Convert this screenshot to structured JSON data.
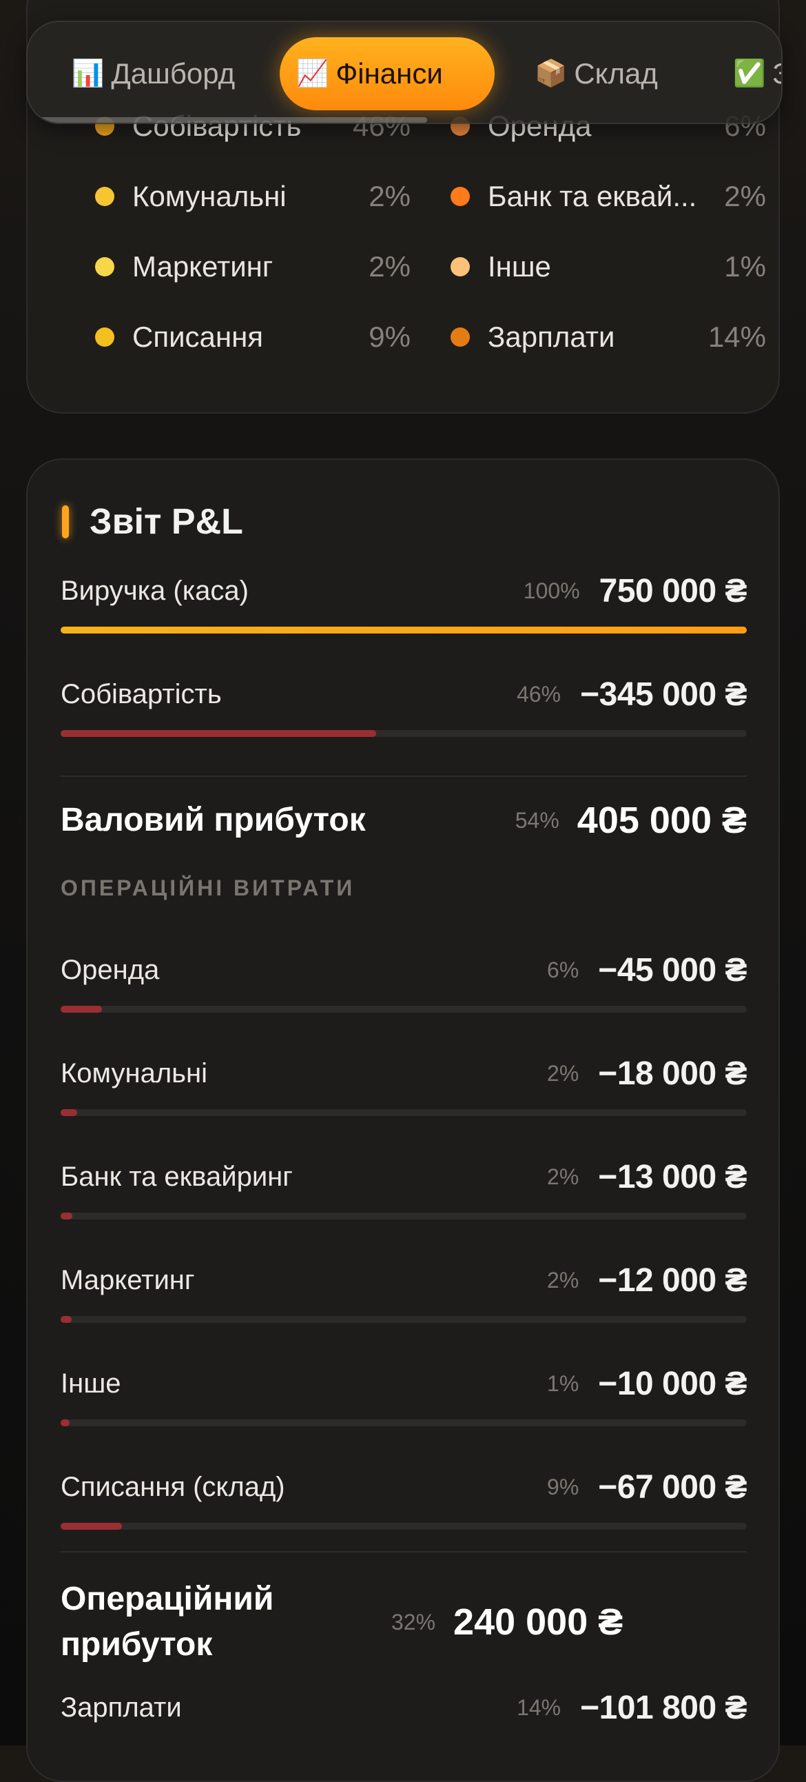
{
  "tabs": [
    {
      "icon": "📊",
      "label": "Дашборд",
      "active": false
    },
    {
      "icon": "📈",
      "label": "Фінанси",
      "active": true
    },
    {
      "icon": "📦",
      "label": "Склад",
      "active": false
    },
    {
      "icon": "✅",
      "label": "З",
      "active": false
    }
  ],
  "legend": [
    {
      "name": "Собівартість",
      "pct": "46%",
      "color": "#f0a81a"
    },
    {
      "name": "Оренда",
      "pct": "6%",
      "color": "#f08a3c"
    },
    {
      "name": "Комунальні",
      "pct": "2%",
      "color": "#f6c532"
    },
    {
      "name": "Банк та еквай...",
      "pct": "2%",
      "color": "#ff7a1a"
    },
    {
      "name": "Маркетинг",
      "pct": "2%",
      "color": "#f7d74a"
    },
    {
      "name": "Інше",
      "pct": "1%",
      "color": "#ffc07a"
    },
    {
      "name": "Списання",
      "pct": "9%",
      "color": "#f3c01d"
    },
    {
      "name": "Зарплати",
      "pct": "14%",
      "color": "#e37d13"
    }
  ],
  "pl": {
    "title": "Звіт P&L",
    "revenue": {
      "label": "Виручка (каса)",
      "pct": "100%",
      "value": "750 000 ₴",
      "fill": 1.0
    },
    "cogs": {
      "label": "Собівартість",
      "pct": "46%",
      "value": "−345 000 ₴",
      "fill": 0.46
    },
    "gross": {
      "label": "Валовий прибуток",
      "pct": "54%",
      "value": "405 000 ₴"
    },
    "opex_caption": "ОПЕРАЦІЙНІ ВИТРАТИ",
    "opex": [
      {
        "label": "Оренда",
        "pct": "6%",
        "value": "−45 000 ₴",
        "fill": 0.06
      },
      {
        "label": "Комунальні",
        "pct": "2%",
        "value": "−18 000 ₴",
        "fill": 0.024
      },
      {
        "label": "Банк та еквайринг",
        "pct": "2%",
        "value": "−13 000 ₴",
        "fill": 0.017
      },
      {
        "label": "Маркетинг",
        "pct": "2%",
        "value": "−12 000 ₴",
        "fill": 0.016
      },
      {
        "label": "Інше",
        "pct": "1%",
        "value": "−10 000 ₴",
        "fill": 0.013
      },
      {
        "label": "Списання (склад)",
        "pct": "9%",
        "value": "−67 000 ₴",
        "fill": 0.089
      }
    ],
    "operating": {
      "label": "Операційний прибуток",
      "pct": "32%",
      "value": "240 000 ₴"
    },
    "salary": {
      "label": "Зарплати",
      "pct": "14%",
      "value": "−101 800 ₴"
    }
  }
}
